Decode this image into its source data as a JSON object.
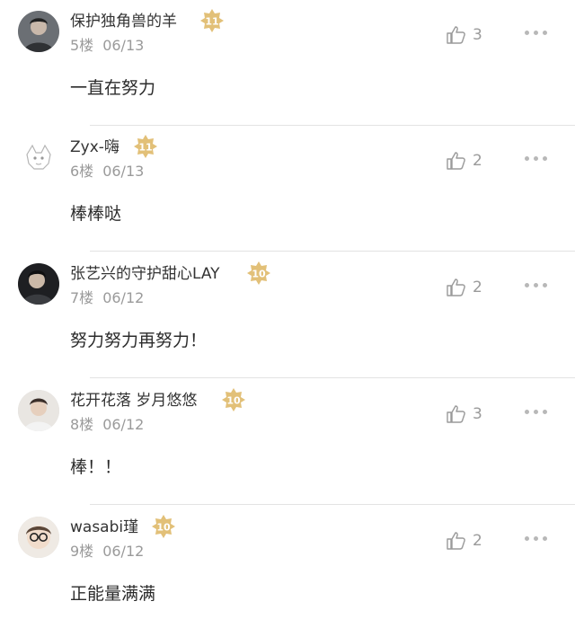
{
  "comments": [
    {
      "username": "保护独角兽的羊",
      "level": "11",
      "floor": "5楼",
      "date": "06/13",
      "likes": "3",
      "text": "一直在努力",
      "avatar_icon": "avatar-dark-portrait"
    },
    {
      "username": "Zyx-嗨",
      "level": "11",
      "floor": "6楼",
      "date": "06/13",
      "likes": "2",
      "text": "棒棒哒",
      "avatar_icon": "avatar-cartoon-sketch"
    },
    {
      "username": "张艺兴的守护甜心LAY",
      "level": "10",
      "floor": "7楼",
      "date": "06/12",
      "likes": "2",
      "text": "努力努力再努力！",
      "avatar_icon": "avatar-dark-portrait"
    },
    {
      "username": "花开花落 岁月悠悠",
      "level": "10",
      "floor": "8楼",
      "date": "06/12",
      "likes": "3",
      "text": "棒！！",
      "avatar_icon": "avatar-light-portrait"
    },
    {
      "username": "wasabi瑾",
      "level": "10",
      "floor": "9楼",
      "date": "06/12",
      "likes": "2",
      "text": "正能量满满",
      "avatar_icon": "avatar-glasses-portrait"
    }
  ],
  "colors": {
    "badge": "#e2c078",
    "badge_text": "#ffffff",
    "meta": "#9a9a9a",
    "divider": "#e3e3e3"
  },
  "icons": {
    "like": "thumbs-up-icon",
    "more": "more-dots-icon",
    "badge": "level-star-badge"
  }
}
